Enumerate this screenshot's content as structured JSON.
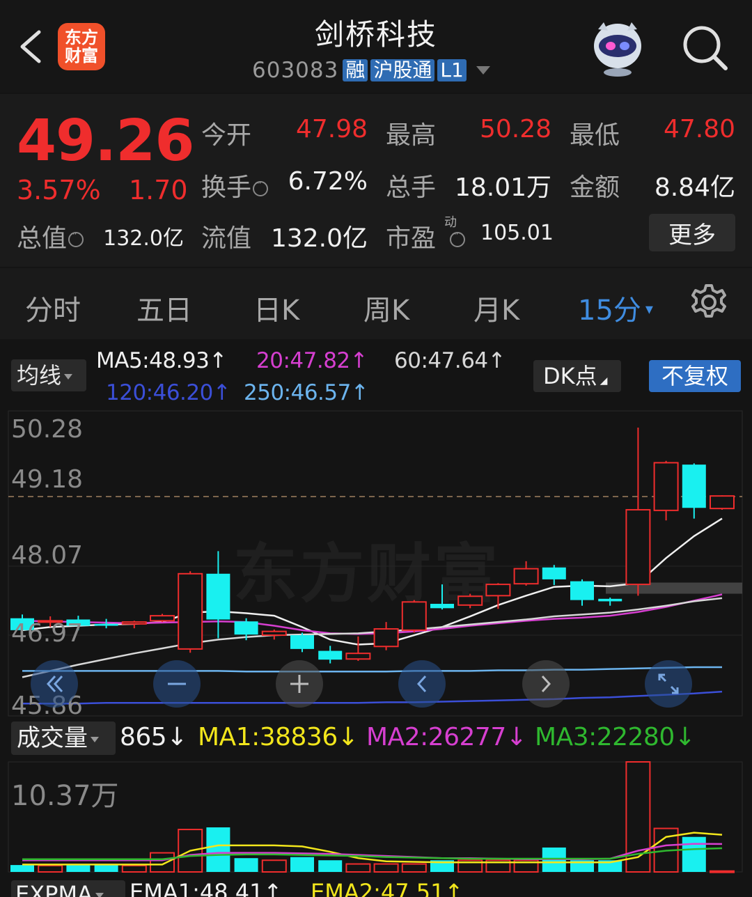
{
  "header": {
    "logo_line1": "东方",
    "logo_line2": "财富",
    "title": "剑桥科技",
    "code": "603083",
    "tags": [
      "融",
      "沪股通",
      "L1"
    ]
  },
  "quote": {
    "price": "49.26",
    "change_pct": "3.57%",
    "change": "1.70",
    "fields": {
      "open_label": "今开",
      "open": "47.98",
      "high_label": "最高",
      "high": "50.28",
      "low_label": "最低",
      "low": "47.80",
      "turnover_label": "换手",
      "turnover": "6.72%",
      "volume_label": "总手",
      "volume": "18.01万",
      "amount_label": "金额",
      "amount": "8.84亿",
      "mktcap_label": "总值",
      "mktcap": "132.0亿",
      "float_label": "流值",
      "float_cap": "132.0亿",
      "pe_label": "市盈",
      "pe_sup": "动",
      "pe": "105.01"
    },
    "more_label": "更多",
    "colors": {
      "up": "#ef2d2d"
    }
  },
  "tabs": {
    "items": [
      "分时",
      "五日",
      "日K",
      "周K",
      "月K",
      "15分"
    ],
    "active_index": 5
  },
  "ma_bar": {
    "selector": "均线",
    "ma5": "MA5:48.93↑",
    "ma20": "20:47.82↑",
    "ma60": "60:47.64↑",
    "ma120": "120:46.20↑",
    "ma250": "250:46.57↑",
    "dk_label": "DK点",
    "adjust_label": "不复权",
    "colors": {
      "ma5": "#f0f0f0",
      "ma20": "#d63fd0",
      "ma60": "#d8d8d8",
      "ma120": "#3b4fd8",
      "ma250": "#6cb4ee"
    }
  },
  "price_axis": [
    "50.28",
    "49.18",
    "48.07",
    "46.97",
    "45.86"
  ],
  "watermark": "东方财富",
  "chart_controls": [
    "rewind-icon",
    "zoom-out-icon",
    "zoom-in-icon",
    "prev-icon",
    "next-icon",
    "fullscreen-icon"
  ],
  "volume_bar": {
    "selector": "成交量",
    "vol": "865↓",
    "ma1": "MA1:38836↓",
    "ma2": "MA2:26277↓",
    "ma3": "MA3:22280↓",
    "axis_max": "10.37万",
    "colors": {
      "ma1": "#f2e61c",
      "ma2": "#d63fd0",
      "ma3": "#2fb82f"
    }
  },
  "expma_bar": {
    "selector": "EXPMA",
    "ema1": "EMA1:48.41↑",
    "ema2": "EMA2:47.51↑"
  },
  "chart_data": {
    "type": "candlestick",
    "period": "15分",
    "ylim": [
      45.86,
      50.28
    ],
    "reference_line": 49.18,
    "candles": [
      {
        "open": 47.24,
        "close": 47.05,
        "high": 47.3,
        "low": 47.02
      },
      {
        "open": 47.18,
        "close": 47.2,
        "high": 47.27,
        "low": 47.1
      },
      {
        "open": 47.22,
        "close": 47.12,
        "high": 47.28,
        "low": 47.05
      },
      {
        "open": 47.15,
        "close": 47.12,
        "high": 47.23,
        "low": 47.08
      },
      {
        "open": 47.15,
        "close": 47.18,
        "high": 47.2,
        "low": 47.08
      },
      {
        "open": 47.2,
        "close": 47.28,
        "high": 47.31,
        "low": 47.18
      },
      {
        "open": 46.75,
        "close": 47.95,
        "high": 47.99,
        "low": 46.69
      },
      {
        "open": 47.95,
        "close": 47.22,
        "high": 48.31,
        "low": 46.92
      },
      {
        "open": 47.19,
        "close": 46.98,
        "high": 47.24,
        "low": 46.89
      },
      {
        "open": 46.97,
        "close": 47.03,
        "high": 47.06,
        "low": 46.9
      },
      {
        "open": 46.97,
        "close": 46.75,
        "high": 47.01,
        "low": 46.7
      },
      {
        "open": 46.72,
        "close": 46.58,
        "high": 46.8,
        "low": 46.52
      },
      {
        "open": 46.59,
        "close": 46.68,
        "high": 46.95,
        "low": 46.56
      },
      {
        "open": 46.79,
        "close": 47.07,
        "high": 47.18,
        "low": 46.73
      },
      {
        "open": 47.05,
        "close": 47.5,
        "high": 47.53,
        "low": 47.01
      },
      {
        "open": 47.47,
        "close": 47.4,
        "high": 47.78,
        "low": 47.38
      },
      {
        "open": 47.45,
        "close": 47.59,
        "high": 47.63,
        "low": 47.4
      },
      {
        "open": 47.6,
        "close": 47.78,
        "high": 47.8,
        "low": 47.39
      },
      {
        "open": 47.79,
        "close": 48.03,
        "high": 48.15,
        "low": 47.76
      },
      {
        "open": 48.05,
        "close": 47.86,
        "high": 48.09,
        "low": 47.77
      },
      {
        "open": 47.83,
        "close": 47.53,
        "high": 47.86,
        "low": 47.44
      },
      {
        "open": 47.55,
        "close": 47.51,
        "high": 47.57,
        "low": 47.44
      },
      {
        "open": 47.78,
        "close": 48.97,
        "high": 50.28,
        "low": 47.6
      },
      {
        "open": 48.96,
        "close": 49.72,
        "high": 49.75,
        "low": 48.8
      },
      {
        "open": 49.69,
        "close": 49.0,
        "high": 49.71,
        "low": 48.83
      },
      {
        "open": 48.99,
        "close": 49.19,
        "high": 49.2,
        "low": 48.97
      }
    ],
    "ma_lines": {
      "MA5": [
        47.05,
        47.1,
        47.12,
        47.14,
        47.15,
        47.18,
        47.33,
        47.35,
        47.32,
        47.28,
        47.1,
        46.9,
        46.82,
        46.84,
        46.97,
        47.1,
        47.27,
        47.45,
        47.6,
        47.74,
        47.76,
        47.75,
        47.8,
        48.2,
        48.55,
        48.83
      ],
      "MA20": [
        47.2,
        47.19,
        47.18,
        47.17,
        47.16,
        47.17,
        47.18,
        47.19,
        47.18,
        47.12,
        47.05,
        47.0,
        46.99,
        47.0,
        47.03,
        47.07,
        47.12,
        47.16,
        47.2,
        47.23,
        47.25,
        47.28,
        47.34,
        47.42,
        47.52,
        47.62
      ],
      "MA60": [
        46.3,
        46.4,
        46.5,
        46.59,
        46.68,
        46.76,
        46.84,
        46.9,
        46.94,
        46.97,
        46.98,
        46.99,
        47.0,
        47.03,
        47.06,
        47.1,
        47.14,
        47.18,
        47.22,
        47.27,
        47.3,
        47.33,
        47.38,
        47.44,
        47.51,
        47.56
      ],
      "MA120": [
        45.88,
        45.88,
        45.88,
        45.89,
        45.89,
        45.89,
        45.89,
        45.89,
        45.89,
        45.89,
        45.89,
        45.89,
        45.89,
        45.9,
        45.9,
        45.91,
        45.92,
        45.93,
        45.94,
        45.95,
        45.97,
        45.98,
        46.0,
        46.02,
        46.04,
        46.07
      ],
      "MA250": [
        46.4,
        46.4,
        46.4,
        46.4,
        46.4,
        46.4,
        46.4,
        46.4,
        46.39,
        46.39,
        46.39,
        46.39,
        46.39,
        46.39,
        46.4,
        46.4,
        46.4,
        46.41,
        46.41,
        46.42,
        46.42,
        46.43,
        46.44,
        46.45,
        46.46,
        46.46
      ]
    },
    "volume": {
      "ylim": [
        0,
        103700
      ],
      "values": [
        6500,
        6000,
        6500,
        7000,
        6000,
        18000,
        40000,
        42000,
        13000,
        11000,
        14000,
        11000,
        7500,
        7500,
        7500,
        11000,
        11000,
        11000,
        11000,
        23000,
        11000,
        11000,
        103700,
        41000,
        33000,
        865
      ],
      "up": [
        false,
        true,
        false,
        false,
        true,
        true,
        true,
        false,
        false,
        true,
        false,
        false,
        true,
        true,
        true,
        false,
        true,
        true,
        true,
        false,
        false,
        false,
        true,
        true,
        false,
        true
      ],
      "MA1": [
        7000,
        7000,
        7000,
        7000,
        7000,
        7000,
        20000,
        25000,
        25000,
        25000,
        24000,
        19000,
        13000,
        10000,
        9500,
        9000,
        9000,
        9000,
        9000,
        9000,
        9000,
        9000,
        14000,
        33000,
        37000,
        35000
      ],
      "MA2": [
        11000,
        11000,
        11000,
        11000,
        11000,
        11000,
        16000,
        18000,
        18000,
        18000,
        17500,
        17000,
        16000,
        15000,
        14000,
        13000,
        13000,
        12500,
        12000,
        12000,
        12000,
        12500,
        20000,
        25000,
        26500,
        26300
      ],
      "MA3": [
        12000,
        12000,
        12000,
        12000,
        12000,
        12000,
        15000,
        16000,
        16500,
        16500,
        16000,
        15500,
        15000,
        14000,
        13500,
        13000,
        12500,
        12500,
        12500,
        12500,
        12500,
        12500,
        17000,
        20000,
        21500,
        22300
      ]
    }
  }
}
